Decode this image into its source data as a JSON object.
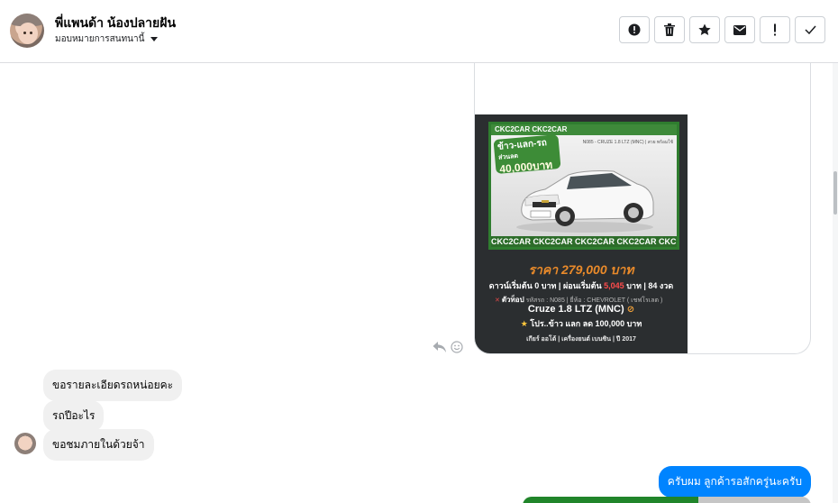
{
  "header": {
    "name": "พี่แพนด้า น้องปลายฝัน",
    "status_label": "มอบหมายการสนทนานี้"
  },
  "actions": [
    {
      "name": "report-icon"
    },
    {
      "name": "trash-icon"
    },
    {
      "name": "star-icon"
    },
    {
      "name": "envelope-icon"
    },
    {
      "name": "exclamation-icon"
    },
    {
      "name": "checkmark-icon"
    }
  ],
  "ad": {
    "strip_top": "CKC2CAR CKC2CAR",
    "model_code": "N085 - CRUZE 1.8 LTZ (MNC) | สวย พร้อมใช้",
    "promo_line1": "ข้าว-แลก-รถ",
    "promo_line2": "ส่วนลด",
    "promo_amount": "40,000บาท",
    "strip_bottom": "CKC2CAR CKC2CAR CKC2CAR CKC2CAR CKC",
    "price": "ราคา 279,000 บาท",
    "terms_prefix": "ดาวน์เริ่มต้น 0 บาท | ผ่อนเริ่มต้น",
    "terms_installment": "5,045",
    "terms_suffix": "บาท | 84 งวด",
    "specs_tag": "ตัวท็อป",
    "specs_detail": "รหัสรถ : N085 | ยี่ห้อ : CHEVROLET ( เชฟโรเลต )",
    "model": "Cruze 1.8 LTZ (MNC)",
    "promo2": "โปร..ข้าว แลก ลด 100,000 บาท",
    "footer": "เกียร์ ออโต้  |  เครื่องยนต์ เบนซิน  |  ปี 2017"
  },
  "messages_in": [
    {
      "text": "ขอรายละเอียดรถหน่อยคะ"
    },
    {
      "text": "รถปีอะไร"
    },
    {
      "text": "ขอชมภายในด้วยจ้า"
    }
  ],
  "messages_out": [
    {
      "text": "ครับผม ลูกค้ารอสักครู่นะครับ"
    }
  ],
  "colors": {
    "accent": "#0084ff",
    "ad_background": "#2b2e30",
    "ad_green": "#3e8a3a",
    "price_orange": "#e98a2a"
  }
}
